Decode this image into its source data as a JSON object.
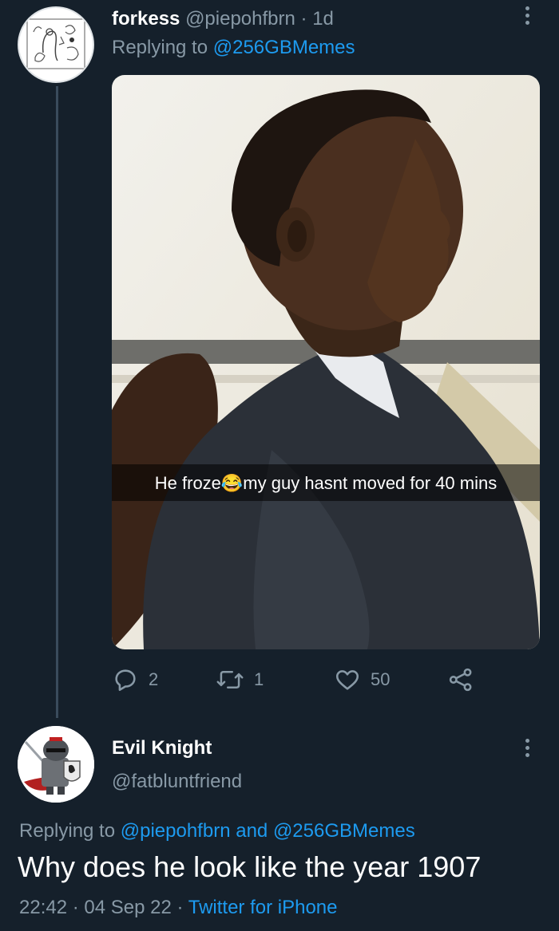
{
  "colors": {
    "background": "#15202b",
    "secondary_text": "#8899a6",
    "link": "#1d9bf0",
    "primary_text": "#ffffff"
  },
  "tweet1": {
    "display_name": "forkess",
    "handle": "@piepohfbrn",
    "separator": "·",
    "time": "1d",
    "replying_prefix": "Replying to",
    "replying_to": "@256GBMemes",
    "media": {
      "caption": "He froze😂my guy hasnt moved for 40 mins"
    },
    "actions": {
      "reply_icon": "reply-icon",
      "reply_count": "2",
      "retweet_icon": "retweet-icon",
      "retweet_count": "1",
      "like_icon": "heart-icon",
      "like_count": "50",
      "share_icon": "share-icon"
    }
  },
  "tweet2": {
    "display_name": "Evil Knight",
    "handle": "@fatbluntfriend",
    "replying_prefix": "Replying to",
    "replying_to_1": "@piepohfbrn",
    "replying_and": "and",
    "replying_to_2": "@256GBMemes",
    "text": "Why does he look like the year 1907",
    "time": "22:42",
    "date": "04 Sep 22",
    "separator": "·",
    "source": "Twitter for iPhone"
  }
}
